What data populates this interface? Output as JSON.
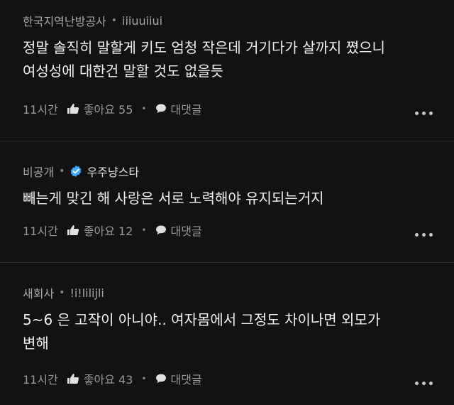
{
  "comments": [
    {
      "author": "한국지역난방공사",
      "handle": "iiiuuiiui",
      "verified": false,
      "lines": [
        "정말 솔직히 말할게 키도 엄청 작은데 거기다가 살까지 쪘으니",
        "여성성에 대한건 말할 것도 없을듯"
      ],
      "time": "11시간",
      "like_label": "좋아요 55",
      "reply_label": "대댓글"
    },
    {
      "author": "비공개",
      "handle": "우주냥스타",
      "verified": true,
      "lines": [
        "빼는게 맞긴 해 사랑은 서로 노력해야 유지되는거지"
      ],
      "time": "11시간",
      "like_label": "좋아요 12",
      "reply_label": "대댓글"
    },
    {
      "author": "새회사",
      "handle": "!i!lilijli",
      "verified": false,
      "lines": [
        "5~6 은 고작이 아니야.. 여자몸에서 그정도 차이나면 외모가",
        "변해"
      ],
      "time": "11시간",
      "like_label": "좋아요 43",
      "reply_label": "대댓글"
    }
  ],
  "icons": {
    "like": "thumbs-up-icon",
    "reply": "chat-bubble-icon",
    "more": "more-horizontal-icon",
    "verified": "verified-badge-icon"
  },
  "colors": {
    "background": "#121212",
    "text": "#f0f0f0",
    "muted": "#a8a8a8",
    "verified": "#3ea6ff"
  }
}
